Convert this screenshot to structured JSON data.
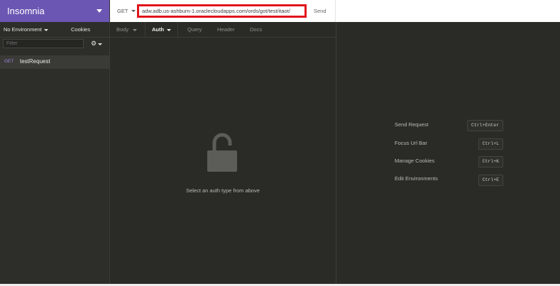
{
  "app": {
    "title": "Insomnia"
  },
  "sidebar": {
    "environment_label": "No Environment",
    "cookies_label": "Cookies",
    "filter_placeholder": "Filter",
    "requests": [
      {
        "method": "GET",
        "name": "testRequest"
      }
    ]
  },
  "urlbar": {
    "method": "GET",
    "url": "adw.adb.us-ashburn-1.oraclecloudapps.com/ords/got/test/itaot/",
    "send_label": "Send"
  },
  "request_tabs": [
    {
      "label": "Body",
      "active": false
    },
    {
      "label": "Auth",
      "active": true
    },
    {
      "label": "Query",
      "active": false
    },
    {
      "label": "Header",
      "active": false
    },
    {
      "label": "Docs",
      "active": false
    }
  ],
  "auth": {
    "message": "Select an auth type from above"
  },
  "shortcuts": [
    {
      "label": "Send Request",
      "keys": "Ctrl+Enter"
    },
    {
      "label": "Focus Url Bar",
      "keys": "Ctrl+L"
    },
    {
      "label": "Manage Cookies",
      "keys": "Ctrl+K"
    },
    {
      "label": "Edit Environments",
      "keys": "Ctrl+E"
    }
  ],
  "colors": {
    "brand": "#6c56b3",
    "highlight": "#e0141b",
    "background": "#2a2a27"
  }
}
